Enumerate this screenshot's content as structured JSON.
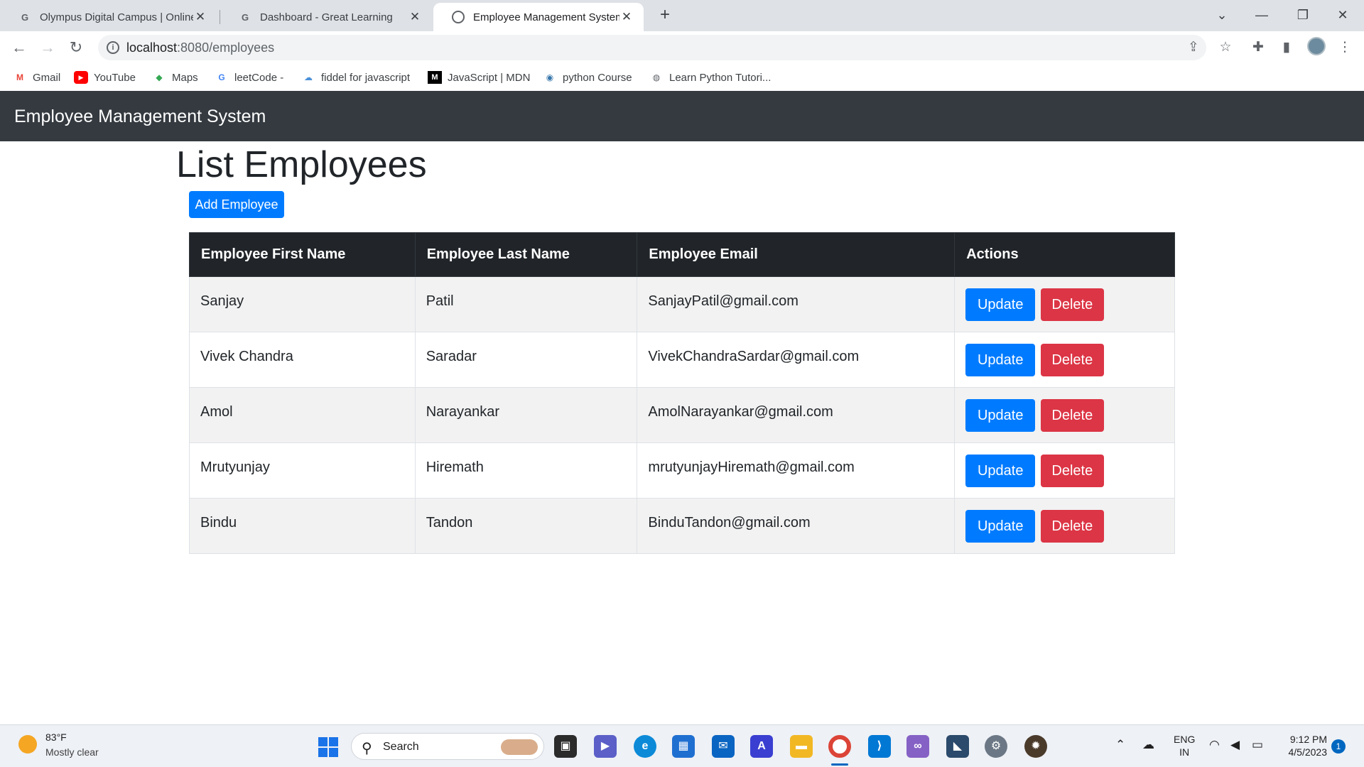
{
  "browser": {
    "tabs": [
      {
        "title": "Olympus Digital Campus | Online",
        "favicon": "google-g-icon"
      },
      {
        "title": "Dashboard - Great Learning",
        "favicon": "google-g-icon"
      },
      {
        "title": "Employee Management System",
        "favicon": "globe-icon"
      }
    ],
    "url_host": "localhost",
    "url_path": ":8080/employees",
    "bookmarks": [
      "Gmail",
      "YouTube",
      "Maps",
      "leetCode -",
      "fiddel for javascript",
      "JavaScript | MDN",
      "python Course",
      "Learn Python Tutori..."
    ]
  },
  "app": {
    "brand": "Employee Management System",
    "page_title": "List Employees",
    "add_button": "Add Employee",
    "columns": [
      "Employee First Name",
      "Employee Last Name",
      "Employee Email",
      "Actions"
    ],
    "update_label": "Update",
    "delete_label": "Delete",
    "employees": [
      {
        "first": "Sanjay",
        "last": "Patil",
        "email": "SanjayPatil@gmail.com"
      },
      {
        "first": "Vivek Chandra",
        "last": "Saradar",
        "email": "VivekChandraSardar@gmail.com"
      },
      {
        "first": "Amol",
        "last": "Narayankar",
        "email": "AmolNarayankar@gmail.com"
      },
      {
        "first": "Mrutyunjay",
        "last": "Hiremath",
        "email": "mrutyunjayHiremath@gmail.com"
      },
      {
        "first": "Bindu",
        "last": "Tandon",
        "email": "BinduTandon@gmail.com"
      }
    ],
    "colors": {
      "navbar": "#343a40",
      "primary": "#007bff",
      "danger": "#dc3545",
      "table_header": "#212529"
    }
  },
  "taskbar": {
    "weather_temp": "83°F",
    "weather_desc": "Mostly clear",
    "search_label": "Search",
    "lang_line1": "ENG",
    "lang_line2": "IN",
    "time": "9:12 PM",
    "date": "4/5/2023",
    "notification_count": "1"
  }
}
